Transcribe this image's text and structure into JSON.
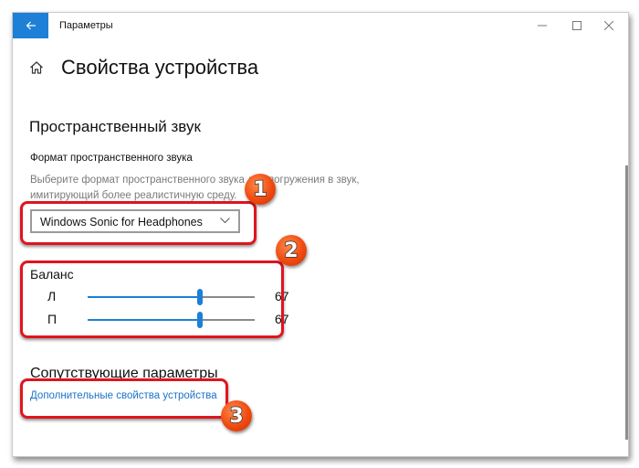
{
  "window": {
    "app_title": "Параметры",
    "icons": {
      "back": "arrow-left-icon",
      "minimize": "minimize-icon",
      "maximize": "maximize-icon",
      "close": "close-icon",
      "home": "home-icon"
    }
  },
  "page": {
    "title": "Свойства устройства"
  },
  "spatial_sound": {
    "section_title": "Пространственный звук",
    "field_label": "Формат пространственного звука",
    "description": "Выберите формат пространственного звука для погружения в звук, имитирующий более реалистичную среду.",
    "dropdown": {
      "selected": "Windows Sonic for Headphones",
      "icon": "chevron-down-icon"
    }
  },
  "balance": {
    "label": "Баланс",
    "channels": [
      {
        "label": "Л",
        "value": 67,
        "value_text": "67",
        "max": 100
      },
      {
        "label": "П",
        "value": 67,
        "value_text": "67",
        "max": 100
      }
    ],
    "accent_color": "#1e7fd6"
  },
  "related": {
    "section_title": "Сопутствующие параметры",
    "link": "Дополнительные свойства устройства",
    "link_color": "#1a73c8"
  },
  "annotations": {
    "badges": [
      "1",
      "2",
      "3"
    ],
    "highlight_color": "#e0141e",
    "badge_color": "#f04a10"
  }
}
